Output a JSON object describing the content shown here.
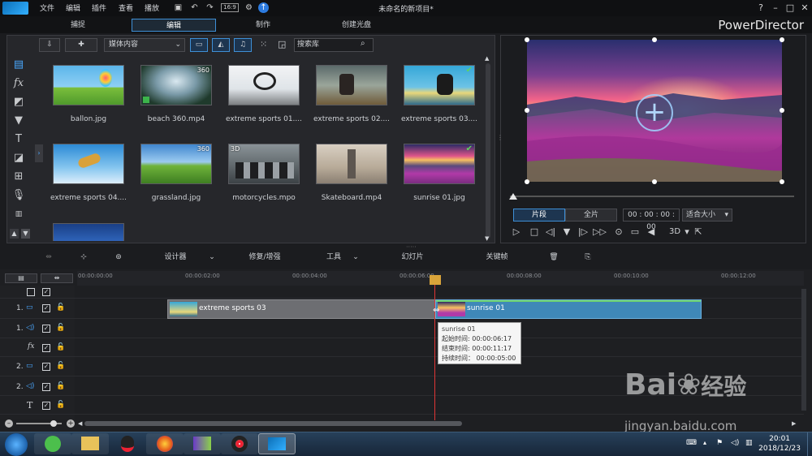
{
  "menu": [
    "文件",
    "编辑",
    "插件",
    "查看",
    "播放"
  ],
  "title": "未命名的新项目*",
  "brand": "PowerDirector",
  "mode_tabs": [
    "捕捉",
    "编辑",
    "制作",
    "创建光盘"
  ],
  "active_mode": "编辑",
  "library": {
    "media_dropdown": "媒体内容",
    "search_placeholder": "搜索库",
    "items": [
      {
        "caption": "ballon.jpg",
        "badge": ""
      },
      {
        "caption": "beach 360.mp4",
        "badge": "360"
      },
      {
        "caption": "extreme sports 01....",
        "badge": ""
      },
      {
        "caption": "extreme sports 02....",
        "badge": ""
      },
      {
        "caption": "extreme sports 03....",
        "badge": "check"
      },
      {
        "caption": "extreme sports 04....",
        "badge": ""
      },
      {
        "caption": "grassland.jpg",
        "badge": "360"
      },
      {
        "caption": "motorcycles.mpo",
        "badge": "3D"
      },
      {
        "caption": "Skateboard.mp4",
        "badge": ""
      },
      {
        "caption": "sunrise 01.jpg",
        "badge": "check"
      }
    ]
  },
  "preview": {
    "segment_label": "片段",
    "full_label": "全片",
    "timecode": "00 : 00 : 00 : 00",
    "fit_size": "适合大小",
    "mode_3d": "3D"
  },
  "timeline_toolbar": {
    "designer": "设计器",
    "fix_enhance": "修复/增强",
    "tools": "工具",
    "slideshow": "幻灯片",
    "keyframe": "关键帧"
  },
  "ruler_ticks": [
    "00:00:00:00",
    "00:00:02:00",
    "00:00:04:00",
    "00:00:06:00",
    "00:00:08:00",
    "00:00:10:00",
    "00:00:12:00"
  ],
  "tracks": [
    {
      "num": "",
      "icon": "square"
    },
    {
      "num": "1.",
      "icon": "video"
    },
    {
      "num": "1.",
      "icon": "audio"
    },
    {
      "num": "",
      "icon": "fx"
    },
    {
      "num": "2.",
      "icon": "video"
    },
    {
      "num": "2.",
      "icon": "audio"
    },
    {
      "num": "",
      "icon": "text"
    }
  ],
  "clips": {
    "clip1": "extreme sports 03",
    "clip2": "sunrise 01"
  },
  "tooltip": {
    "name": "sunrise 01",
    "start": "起始时间: 00:00:06:17",
    "end": "结束时间: 00:00:11:17",
    "duration": "持续时间： 00:00:05:00"
  },
  "clock": {
    "time": "20:01",
    "date": "2018/12/23"
  },
  "watermark": {
    "brand": "Bai",
    "brand_cn": "经验",
    "url": "jingyan.baidu.com"
  },
  "colors": {
    "accent": "#3e8fd6",
    "playhead": "#e03535",
    "clip_video": "#3f88b8"
  }
}
